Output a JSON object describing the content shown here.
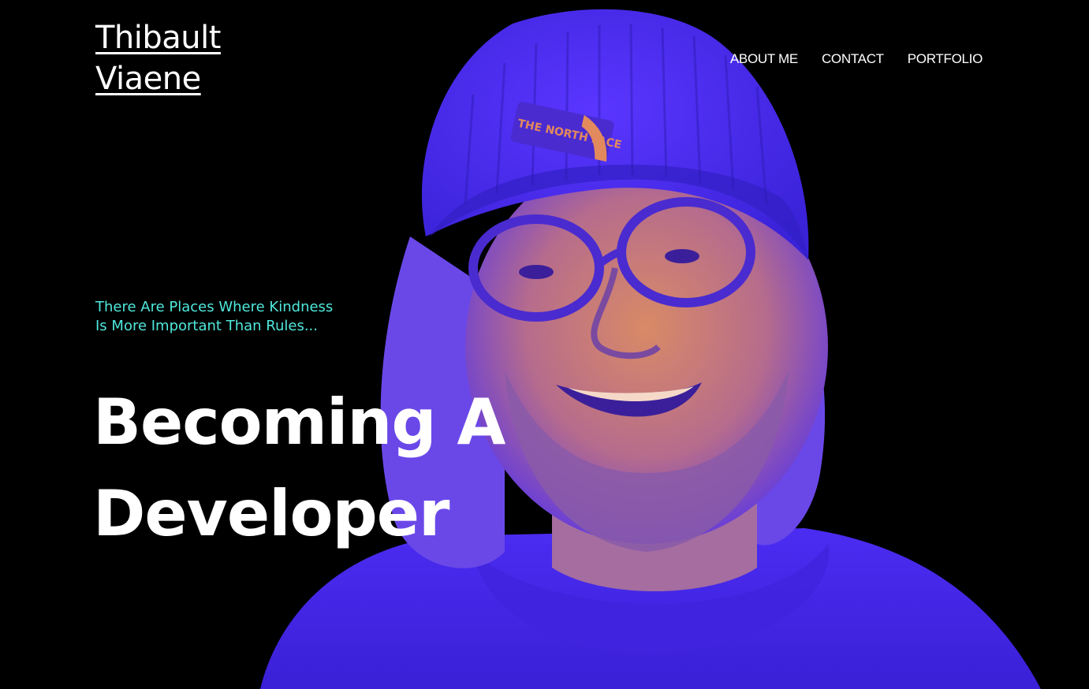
{
  "header": {
    "brand_line1": "Thibault",
    "brand_line2": "Viaene"
  },
  "nav": {
    "items": [
      {
        "label": "ABOUT ME"
      },
      {
        "label": "CONTACT"
      },
      {
        "label": "PORTFOLIO"
      }
    ]
  },
  "hero": {
    "tagline_line1": "There Are Places Where Kindness",
    "tagline_line2": "Is More Important Than Rules...",
    "headline_line1": "Becoming A",
    "headline_line2": "Developer",
    "beanie_logo_text": "THE NORTH FACE"
  },
  "colors": {
    "background": "#000000",
    "accent": "#4fe8dc",
    "text": "#ffffff",
    "duotone_shadow": "#4a2bff",
    "duotone_highlight": "#e2895e"
  },
  "icons": {
    "portrait": "person-portrait-image"
  }
}
